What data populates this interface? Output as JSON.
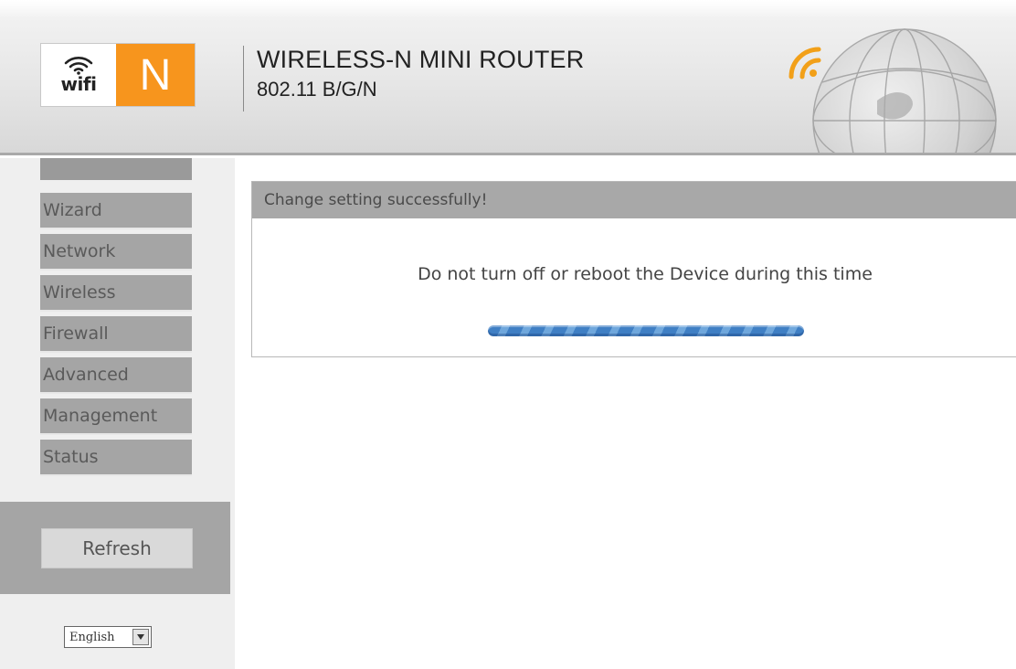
{
  "header": {
    "logo_wifi_text": "wifi",
    "logo_letter": "N",
    "product_title": "WIRELESS-N MINI ROUTER",
    "product_subtitle": "802.11 B/G/N"
  },
  "sidebar": {
    "items": [
      {
        "label": "Wizard"
      },
      {
        "label": "Network"
      },
      {
        "label": "Wireless"
      },
      {
        "label": "Firewall"
      },
      {
        "label": "Advanced"
      },
      {
        "label": "Management"
      },
      {
        "label": "Status"
      }
    ],
    "refresh_label": "Refresh",
    "language": {
      "selected": "English",
      "icon": "dropdown-arrow-icon"
    }
  },
  "main": {
    "panel_title": "Change setting successfully!",
    "notice": "Do not turn off or reboot the Device during this time",
    "progress": {
      "percent": 100
    }
  },
  "colors": {
    "logo_orange": "#f7951d",
    "nav_bg": "#a5a5a5",
    "nav_text": "#5a5a5a",
    "panel_header_bg": "#a8a8a8",
    "progress_blue": "#3f7fc4"
  }
}
